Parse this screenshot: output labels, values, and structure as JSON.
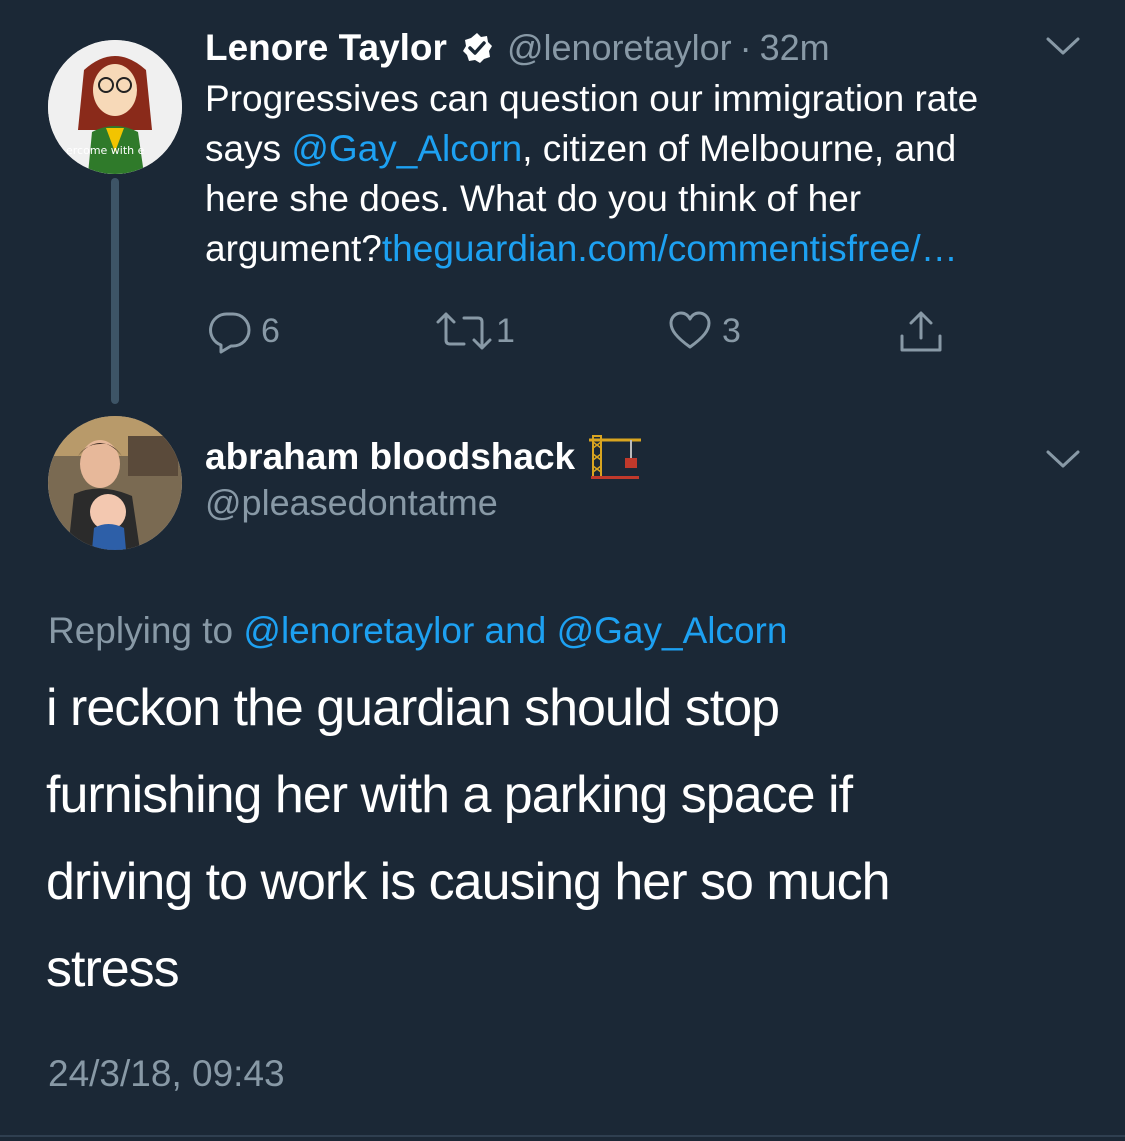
{
  "tweet": {
    "author_name": "Lenore Taylor",
    "author_handle": "@lenoretaylor",
    "separator": "·",
    "time_ago": "32m",
    "avatar_caption": "ercome with e",
    "text_line1": "Progressives can question our immigration rate",
    "text_line2_a": "says ",
    "text_line2_mention": "@Gay_Alcorn",
    "text_line2_b": ", citizen of Melbourne, and",
    "text_line3": "here she does. What do you think of her",
    "text_line4_a": "argument?",
    "text_line4_link": "theguardian.com/commentisfree/…",
    "reply_count": "6",
    "retweet_count": "1",
    "like_count": "3"
  },
  "reply": {
    "author_name": "abraham bloodshack",
    "author_emoji": "🏗",
    "author_handle": "@pleasedontatme",
    "replying_prefix": "Replying to ",
    "replying_mention1": "@lenoretaylor",
    "replying_and": " and ",
    "replying_mention2": "@Gay_Alcorn",
    "text_line1": "i reckon the guardian should stop",
    "text_line2": "furnishing her with a parking space if",
    "text_line3": "driving to work is causing her so much",
    "text_line4": "stress",
    "timestamp": "24/3/18, 09:43"
  },
  "colors": {
    "background": "#1b2836",
    "link": "#1da1f2",
    "secondary_text": "#8899a6",
    "verified": "#ffffff"
  },
  "icons": [
    "verified-badge-icon",
    "chevron-down-icon",
    "reply-icon",
    "retweet-icon",
    "like-icon",
    "share-icon",
    "crane-emoji-icon"
  ]
}
